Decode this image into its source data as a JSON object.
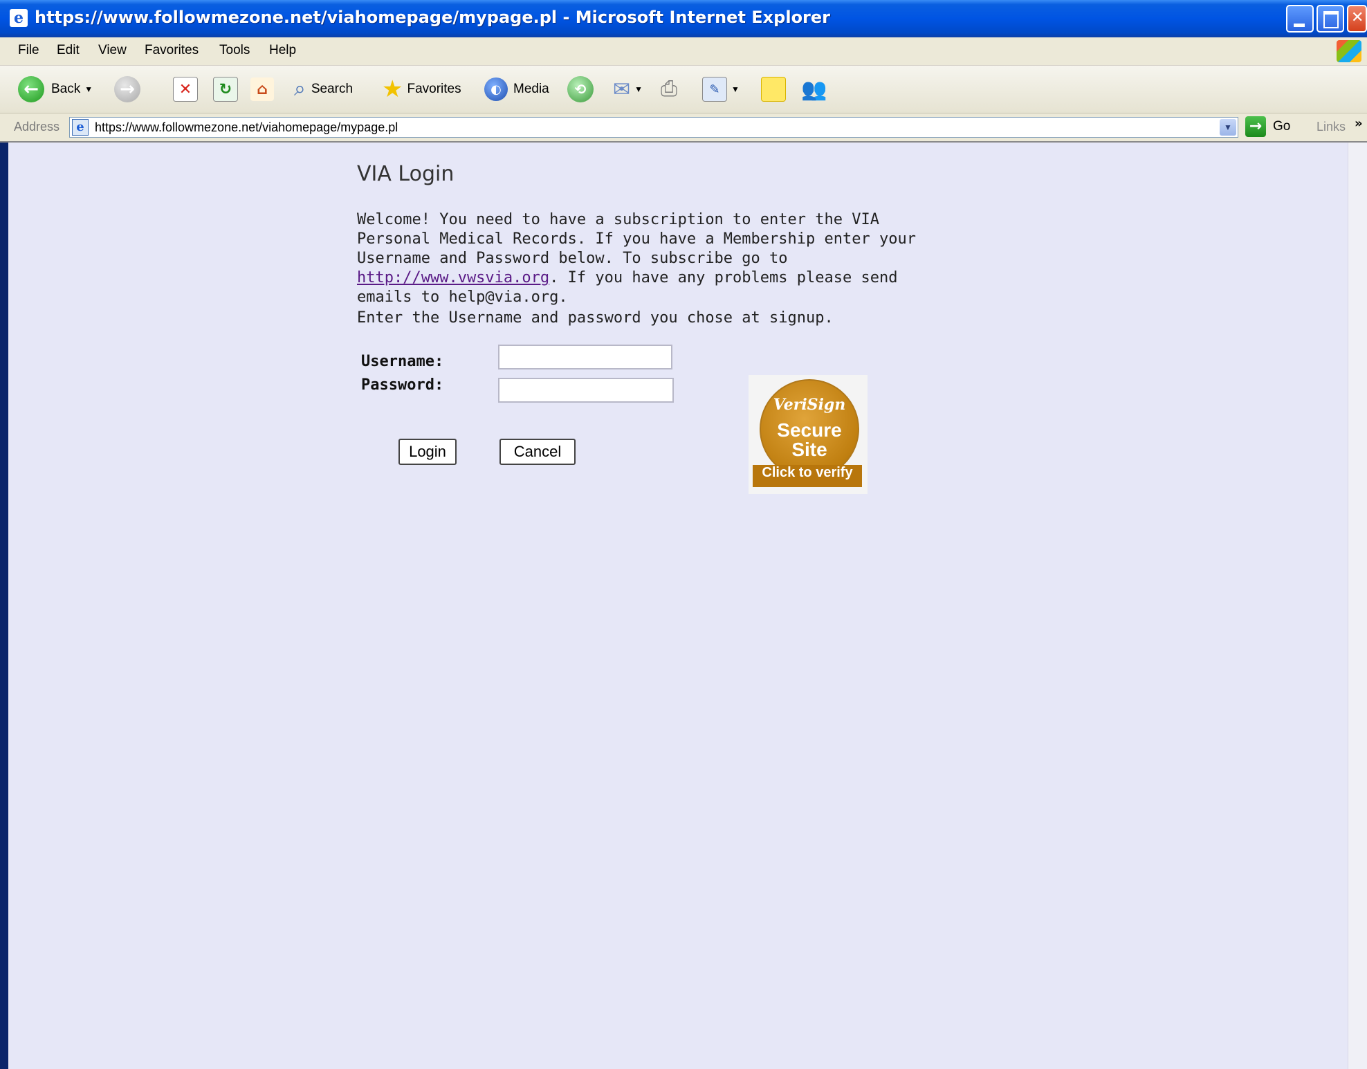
{
  "window": {
    "title": "https://www.followmezone.net/viahomepage/mypage.pl - Microsoft Internet Explorer"
  },
  "menu": {
    "items": [
      "File",
      "Edit",
      "View",
      "Favorites",
      "Tools",
      "Help"
    ]
  },
  "toolbar": {
    "back_label": "Back",
    "search_label": "Search",
    "favorites_label": "Favorites",
    "media_label": "Media"
  },
  "address": {
    "label": "Address",
    "url": "https://www.followmezone.net/viahomepage/mypage.pl",
    "go_label": "Go",
    "links_label": "Links"
  },
  "page": {
    "title": "VIA Login",
    "welcome_before": "Welcome! You need to have a subscription to enter the VIA Personal Medical Records. If you have a Membership enter your Username and Password below. To subscribe go to ",
    "welcome_link": "http://www.vwsvia.org",
    "welcome_after": ". If you have any problems please send emails to help@via.org.",
    "instruction": "Enter the Username and password you chose at signup.",
    "username_label": "Username:",
    "password_label": "Password:",
    "username_value": "",
    "password_value": "",
    "login_label": "Login",
    "cancel_label": "Cancel"
  },
  "seal": {
    "brand": "VeriSign",
    "line1": "Secure",
    "line2": "Site",
    "verify": "Click to verify"
  },
  "colors": {
    "titlebar": "#0054e3",
    "content_bg": "#e6e7f7",
    "link_visited": "#5a1a86",
    "seal_gold": "#c07f10"
  }
}
